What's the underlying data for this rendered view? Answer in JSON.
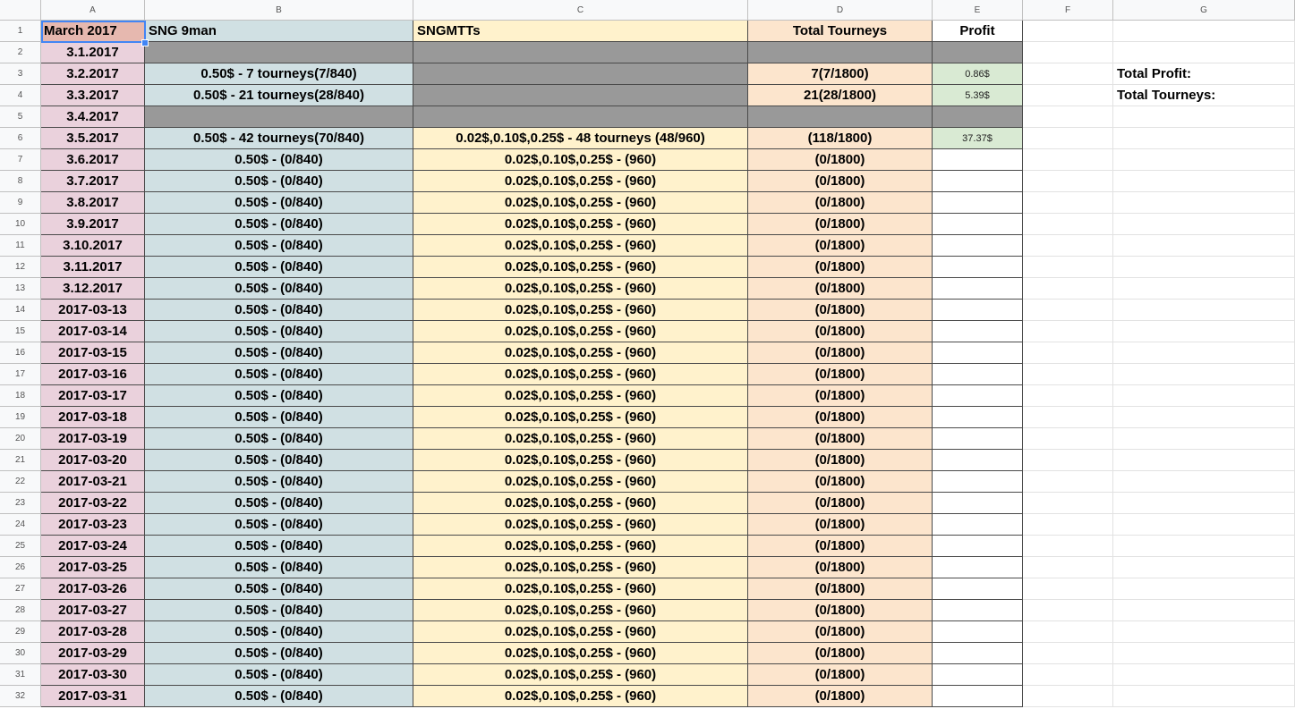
{
  "columns": [
    "A",
    "B",
    "C",
    "D",
    "E",
    "F",
    "G"
  ],
  "rows": [
    {
      "num": "1",
      "a": "March 2017",
      "b": "SNG 9man",
      "c": "SNGMTTs",
      "d": "Total Tourneys",
      "e": "Profit",
      "f": "",
      "g": "",
      "kind": "header"
    },
    {
      "num": "2",
      "a": "3.1.2017",
      "b": "",
      "c": "",
      "d": "",
      "e": "",
      "f": "",
      "g": "",
      "kind": "gray"
    },
    {
      "num": "3",
      "a": "3.2.2017",
      "b": "0.50$ - 7 tourneys(7/840)",
      "c": "",
      "d": "7(7/1800)",
      "e": "0.86$",
      "f": "",
      "g": "Total Profit:",
      "kind": "c-gray"
    },
    {
      "num": "4",
      "a": "3.3.2017",
      "b": "0.50$ - 21 tourneys(28/840)",
      "c": "",
      "d": "21(28/1800)",
      "e": "5.39$",
      "f": "",
      "g": "Total Tourneys:",
      "kind": "c-gray"
    },
    {
      "num": "5",
      "a": "3.4.2017",
      "b": "",
      "c": "",
      "d": "",
      "e": "",
      "f": "",
      "g": "",
      "kind": "gray"
    },
    {
      "num": "6",
      "a": "3.5.2017",
      "b": "0.50$ - 42 tourneys(70/840)",
      "c": "0.02$,0.10$,0.25$ - 48 tourneys (48/960)",
      "d": "(118/1800)",
      "e": "37.37$",
      "f": "",
      "g": "",
      "kind": "normal-green"
    },
    {
      "num": "7",
      "a": "3.6.2017",
      "b": "0.50$ - (0/840)",
      "c": "0.02$,0.10$,0.25$ - (960)",
      "d": "(0/1800)",
      "e": "",
      "f": "",
      "g": "",
      "kind": "normal"
    },
    {
      "num": "8",
      "a": "3.7.2017",
      "b": "0.50$ - (0/840)",
      "c": "0.02$,0.10$,0.25$ - (960)",
      "d": "(0/1800)",
      "e": "",
      "f": "",
      "g": "",
      "kind": "normal"
    },
    {
      "num": "9",
      "a": "3.8.2017",
      "b": "0.50$ - (0/840)",
      "c": "0.02$,0.10$,0.25$ - (960)",
      "d": "(0/1800)",
      "e": "",
      "f": "",
      "g": "",
      "kind": "normal"
    },
    {
      "num": "10",
      "a": "3.9.2017",
      "b": "0.50$ - (0/840)",
      "c": "0.02$,0.10$,0.25$ - (960)",
      "d": "(0/1800)",
      "e": "",
      "f": "",
      "g": "",
      "kind": "normal"
    },
    {
      "num": "11",
      "a": "3.10.2017",
      "b": "0.50$ - (0/840)",
      "c": "0.02$,0.10$,0.25$ - (960)",
      "d": "(0/1800)",
      "e": "",
      "f": "",
      "g": "",
      "kind": "normal"
    },
    {
      "num": "12",
      "a": "3.11.2017",
      "b": "0.50$ - (0/840)",
      "c": "0.02$,0.10$,0.25$ - (960)",
      "d": "(0/1800)",
      "e": "",
      "f": "",
      "g": "",
      "kind": "normal"
    },
    {
      "num": "13",
      "a": "3.12.2017",
      "b": "0.50$ - (0/840)",
      "c": "0.02$,0.10$,0.25$ - (960)",
      "d": "(0/1800)",
      "e": "",
      "f": "",
      "g": "",
      "kind": "normal"
    },
    {
      "num": "14",
      "a": "2017-03-13",
      "b": "0.50$ - (0/840)",
      "c": "0.02$,0.10$,0.25$ - (960)",
      "d": "(0/1800)",
      "e": "",
      "f": "",
      "g": "",
      "kind": "normal"
    },
    {
      "num": "15",
      "a": "2017-03-14",
      "b": "0.50$ - (0/840)",
      "c": "0.02$,0.10$,0.25$ - (960)",
      "d": "(0/1800)",
      "e": "",
      "f": "",
      "g": "",
      "kind": "normal"
    },
    {
      "num": "16",
      "a": "2017-03-15",
      "b": "0.50$ - (0/840)",
      "c": "0.02$,0.10$,0.25$ - (960)",
      "d": "(0/1800)",
      "e": "",
      "f": "",
      "g": "",
      "kind": "normal"
    },
    {
      "num": "17",
      "a": "2017-03-16",
      "b": "0.50$ - (0/840)",
      "c": "0.02$,0.10$,0.25$ - (960)",
      "d": "(0/1800)",
      "e": "",
      "f": "",
      "g": "",
      "kind": "normal"
    },
    {
      "num": "18",
      "a": "2017-03-17",
      "b": "0.50$ - (0/840)",
      "c": "0.02$,0.10$,0.25$ - (960)",
      "d": "(0/1800)",
      "e": "",
      "f": "",
      "g": "",
      "kind": "normal"
    },
    {
      "num": "19",
      "a": "2017-03-18",
      "b": "0.50$ - (0/840)",
      "c": "0.02$,0.10$,0.25$ - (960)",
      "d": "(0/1800)",
      "e": "",
      "f": "",
      "g": "",
      "kind": "normal"
    },
    {
      "num": "20",
      "a": "2017-03-19",
      "b": "0.50$ - (0/840)",
      "c": "0.02$,0.10$,0.25$ - (960)",
      "d": "(0/1800)",
      "e": "",
      "f": "",
      "g": "",
      "kind": "normal"
    },
    {
      "num": "21",
      "a": "2017-03-20",
      "b": "0.50$ - (0/840)",
      "c": "0.02$,0.10$,0.25$ - (960)",
      "d": "(0/1800)",
      "e": "",
      "f": "",
      "g": "",
      "kind": "normal"
    },
    {
      "num": "22",
      "a": "2017-03-21",
      "b": "0.50$ - (0/840)",
      "c": "0.02$,0.10$,0.25$ - (960)",
      "d": "(0/1800)",
      "e": "",
      "f": "",
      "g": "",
      "kind": "normal"
    },
    {
      "num": "23",
      "a": "2017-03-22",
      "b": "0.50$ - (0/840)",
      "c": "0.02$,0.10$,0.25$ - (960)",
      "d": "(0/1800)",
      "e": "",
      "f": "",
      "g": "",
      "kind": "normal"
    },
    {
      "num": "24",
      "a": "2017-03-23",
      "b": "0.50$ - (0/840)",
      "c": "0.02$,0.10$,0.25$ - (960)",
      "d": "(0/1800)",
      "e": "",
      "f": "",
      "g": "",
      "kind": "normal"
    },
    {
      "num": "25",
      "a": "2017-03-24",
      "b": "0.50$ - (0/840)",
      "c": "0.02$,0.10$,0.25$ - (960)",
      "d": "(0/1800)",
      "e": "",
      "f": "",
      "g": "",
      "kind": "normal"
    },
    {
      "num": "26",
      "a": "2017-03-25",
      "b": "0.50$ - (0/840)",
      "c": "0.02$,0.10$,0.25$ - (960)",
      "d": "(0/1800)",
      "e": "",
      "f": "",
      "g": "",
      "kind": "normal"
    },
    {
      "num": "27",
      "a": "2017-03-26",
      "b": "0.50$ - (0/840)",
      "c": "0.02$,0.10$,0.25$ - (960)",
      "d": "(0/1800)",
      "e": "",
      "f": "",
      "g": "",
      "kind": "normal"
    },
    {
      "num": "28",
      "a": "2017-03-27",
      "b": "0.50$ - (0/840)",
      "c": "0.02$,0.10$,0.25$ - (960)",
      "d": "(0/1800)",
      "e": "",
      "f": "",
      "g": "",
      "kind": "normal"
    },
    {
      "num": "29",
      "a": "2017-03-28",
      "b": "0.50$ - (0/840)",
      "c": "0.02$,0.10$,0.25$ - (960)",
      "d": "(0/1800)",
      "e": "",
      "f": "",
      "g": "",
      "kind": "normal"
    },
    {
      "num": "30",
      "a": "2017-03-29",
      "b": "0.50$ - (0/840)",
      "c": "0.02$,0.10$,0.25$ - (960)",
      "d": "(0/1800)",
      "e": "",
      "f": "",
      "g": "",
      "kind": "normal"
    },
    {
      "num": "31",
      "a": "2017-03-30",
      "b": "0.50$ - (0/840)",
      "c": "0.02$,0.10$,0.25$ - (960)",
      "d": "(0/1800)",
      "e": "",
      "f": "",
      "g": "",
      "kind": "normal"
    },
    {
      "num": "32",
      "a": "2017-03-31",
      "b": "0.50$ - (0/840)",
      "c": "0.02$,0.10$,0.25$ - (960)",
      "d": "(0/1800)",
      "e": "",
      "f": "",
      "g": "",
      "kind": "normal"
    }
  ],
  "colors": {
    "date_cell": "#ead1dc",
    "month_header": "#e6b8af",
    "sng_column": "#d0e0e3",
    "mtt_column": "#fff2cc",
    "total_column": "#fce5cd",
    "profit_positive": "#d9ead3",
    "blocked_day": "#999999",
    "selection": "#4285f4"
  }
}
